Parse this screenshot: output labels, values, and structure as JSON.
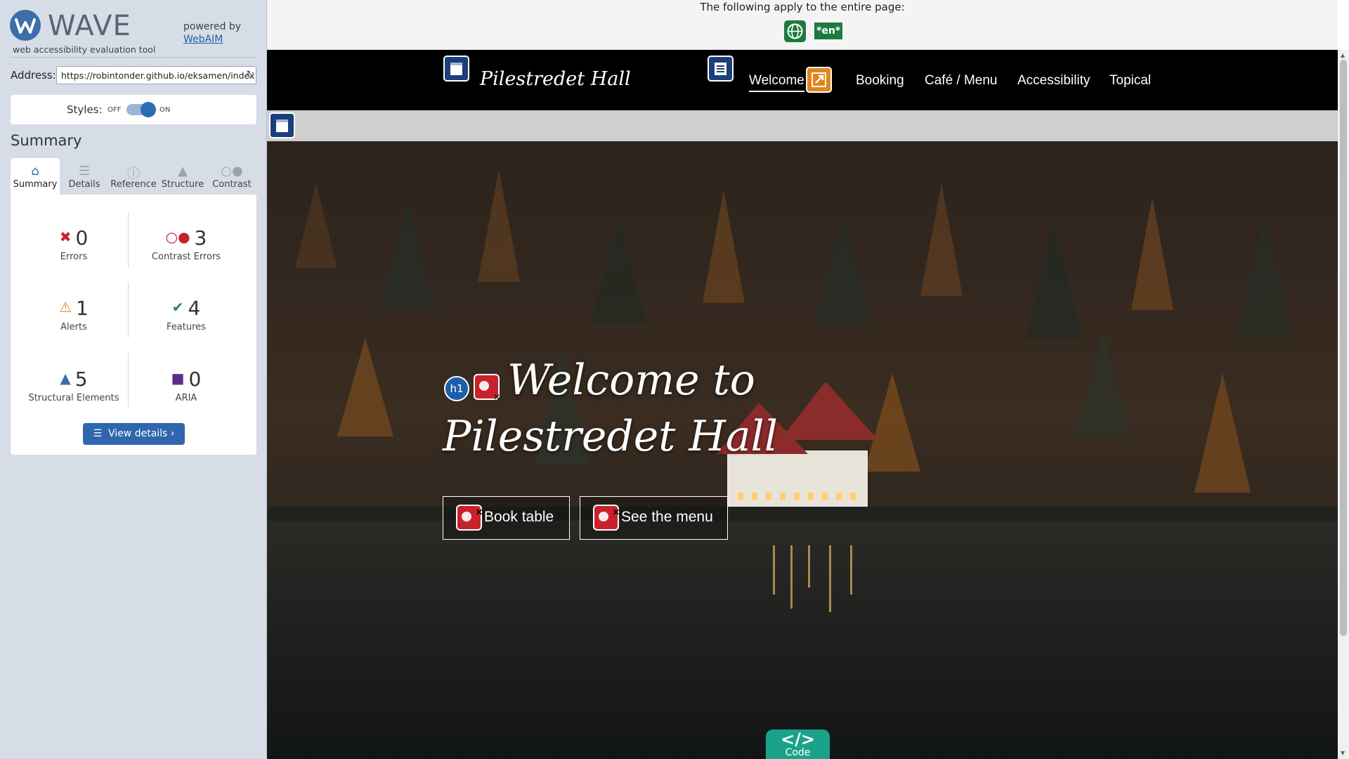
{
  "wave": {
    "brand": "WAVE",
    "tagline": "web accessibility evaluation tool",
    "powered_by": "powered by",
    "webaim": "WebAIM",
    "address_label": "Address:",
    "address_value": "https://robintonder.github.io/eksamen/index",
    "styles_label": "Styles:",
    "styles_off": "OFF",
    "styles_on": "ON",
    "summary_heading": "Summary",
    "tabs": [
      {
        "label": "Summary",
        "icon": "home-icon"
      },
      {
        "label": "Details",
        "icon": "list-icon"
      },
      {
        "label": "Reference",
        "icon": "info-icon"
      },
      {
        "label": "Structure",
        "icon": "structure-icon"
      },
      {
        "label": "Contrast",
        "icon": "contrast-icon"
      }
    ],
    "stats": {
      "errors": {
        "value": "0",
        "label": "Errors",
        "color": "#c9212b"
      },
      "contrast": {
        "value": "3",
        "label": "Contrast Errors",
        "color": "#c9212b"
      },
      "alerts": {
        "value": "1",
        "label": "Alerts",
        "color": "#e0861d"
      },
      "features": {
        "value": "4",
        "label": "Features",
        "color": "#2a8a4a"
      },
      "structural": {
        "value": "5",
        "label": "Structural Elements",
        "color": "#3c6ea8"
      },
      "aria": {
        "value": "0",
        "label": "ARIA",
        "color": "#5b2d8c"
      }
    },
    "view_details": "View details ›"
  },
  "page": {
    "notice": "The following apply to the entire page:",
    "lang": "*en*",
    "brand": "Pilestredet Hall",
    "nav": [
      "Welcome",
      "Booking",
      "Café / Menu",
      "Accessibility",
      "Topical"
    ],
    "hero_line1": "Welcome to",
    "hero_line2": "Pilestredet Hall",
    "book_btn": "Book table",
    "menu_btn": "See the menu",
    "h1_badge": "h1",
    "code_symbol": "</>",
    "code_label": "Code"
  }
}
